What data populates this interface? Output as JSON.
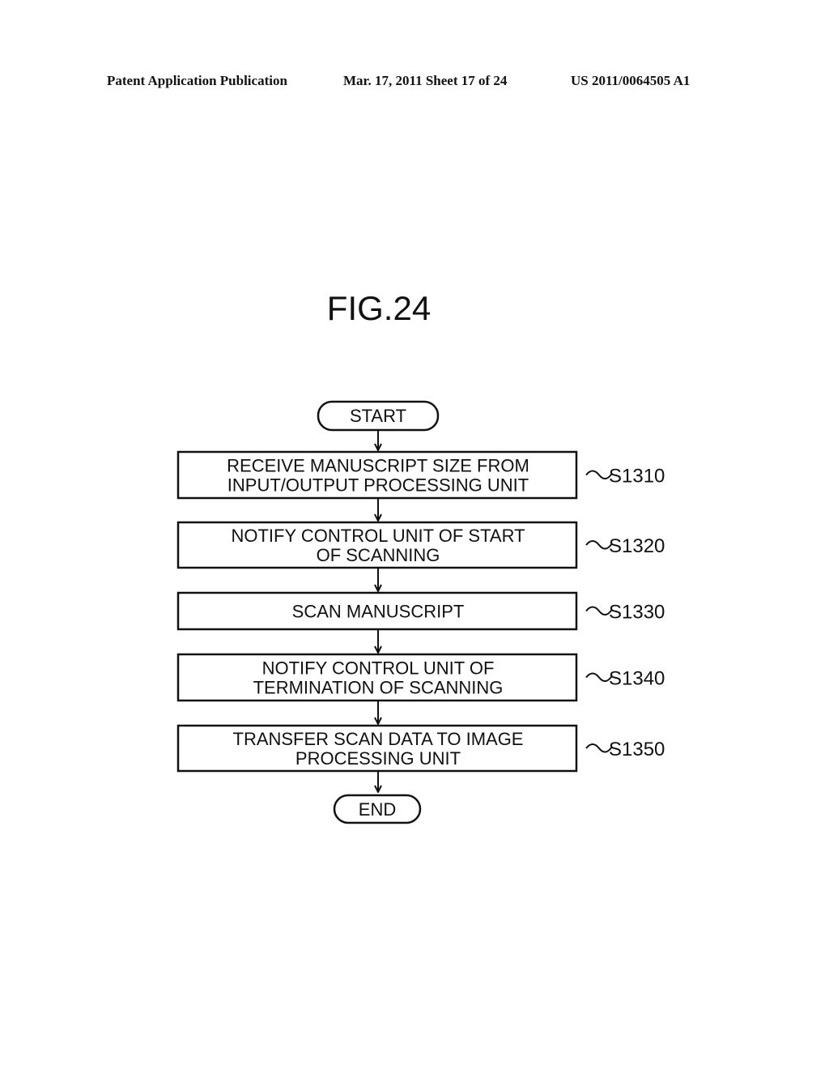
{
  "header": {
    "publication": "Patent Application Publication",
    "date_sheet": "Mar. 17, 2011  Sheet 17 of 24",
    "patent_number": "US 2011/0064505 A1"
  },
  "figure": {
    "title": "FIG.24",
    "start_label": "START",
    "end_label": "END",
    "steps": [
      {
        "id": "S1310",
        "lines": [
          "RECEIVE MANUSCRIPT SIZE FROM",
          "INPUT/OUTPUT PROCESSING UNIT"
        ]
      },
      {
        "id": "S1320",
        "lines": [
          "NOTIFY CONTROL UNIT OF START",
          "OF SCANNING"
        ]
      },
      {
        "id": "S1330",
        "lines": [
          "SCAN MANUSCRIPT"
        ]
      },
      {
        "id": "S1340",
        "lines": [
          "NOTIFY CONTROL UNIT OF",
          "TERMINATION OF SCANNING"
        ]
      },
      {
        "id": "S1350",
        "lines": [
          "TRANSFER SCAN DATA TO IMAGE",
          "PROCESSING UNIT"
        ]
      }
    ]
  }
}
